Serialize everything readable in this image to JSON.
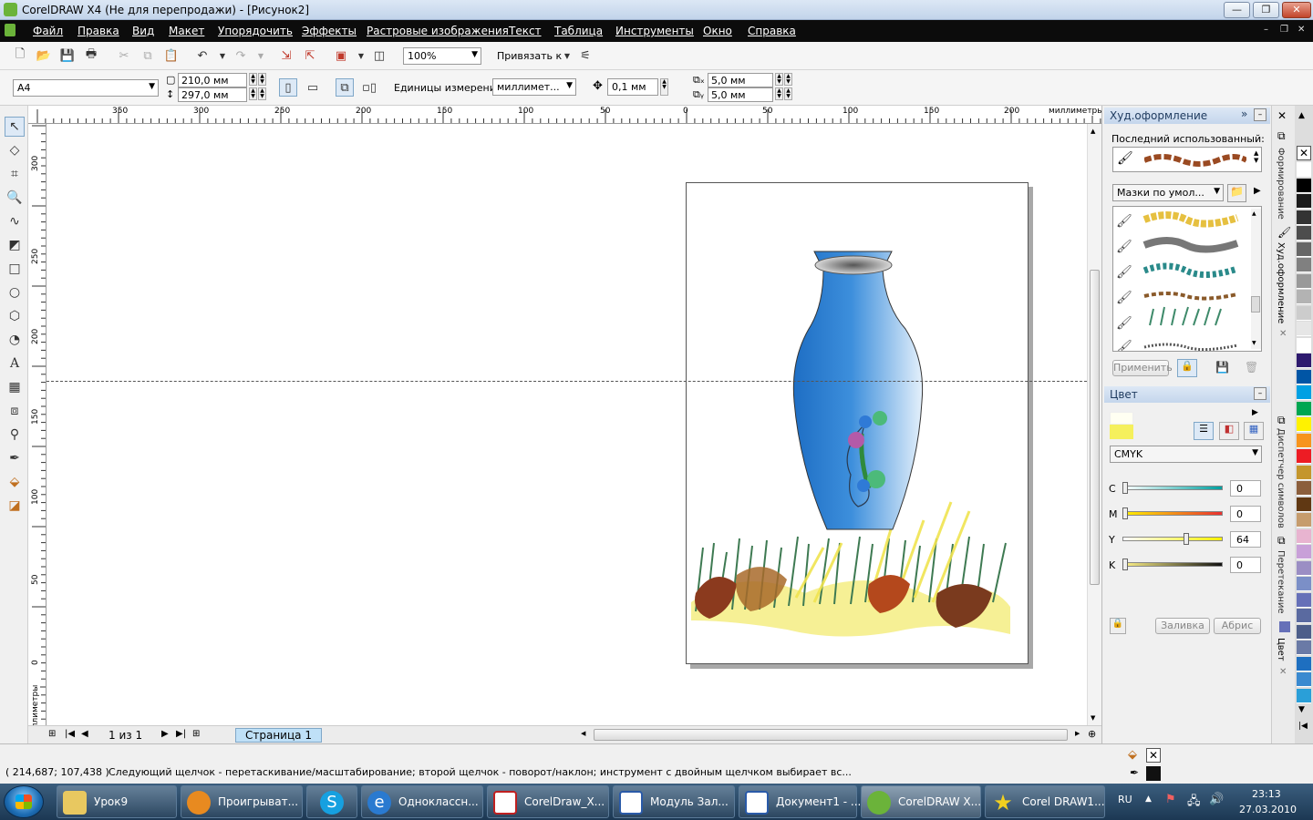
{
  "window": {
    "title": "CorelDRAW X4 (Не для перепродажи) - [Рисунок2]",
    "min": "—",
    "max": "❐",
    "close": "✕"
  },
  "menu": [
    "Файл",
    "Правка",
    "Вид",
    "Макет",
    "Упорядочить",
    "Эффекты",
    "Растровые изображения",
    "Текст",
    "Таблица",
    "Инструменты",
    "Окно",
    "Справка"
  ],
  "doc_controls": {
    "min": "–",
    "restore": "❐",
    "close": "✕"
  },
  "standard_bar": {
    "zoom": "100%",
    "snap_label": "Привязать к"
  },
  "property_bar": {
    "paper": "A4",
    "width": "210,0 мм",
    "height": "297,0 мм",
    "units_label": "Единицы измерения:",
    "units": "миллимет...",
    "nudge": "0,1 мм",
    "dup_x": "5,0 мм",
    "dup_y": "5,0 мм"
  },
  "ruler": {
    "h_ticks": [
      "350",
      "300",
      "250",
      "200",
      "150",
      "100",
      "50",
      "0",
      "50",
      "100",
      "150",
      "200"
    ],
    "unit": "миллиметры",
    "v_ticks": [
      "300",
      "250",
      "200",
      "150",
      "100",
      "50",
      "0"
    ],
    "v_unit": "миллиметры"
  },
  "page_nav": {
    "counter": "1 из 1",
    "tab": "Страница 1"
  },
  "artistic_docker": {
    "title": "Худ.оформление",
    "recent_label": "Последний использованный:",
    "library": "Мазки по умол...",
    "apply": "Применить"
  },
  "color_docker": {
    "title": "Цвет",
    "model": "CMYK",
    "channels": [
      {
        "label": "C",
        "value": "0",
        "level": 0
      },
      {
        "label": "M",
        "value": "0",
        "level": 0
      },
      {
        "label": "Y",
        "value": "64",
        "level": 64
      },
      {
        "label": "K",
        "value": "0",
        "level": 0
      }
    ],
    "fill_btn": "Заливка",
    "outline_btn": "Абрис"
  },
  "side_tabs": [
    "Формирование",
    "Худ.оформление",
    "Диспетчер символов",
    "Перетекание",
    "Цвет"
  ],
  "palette": [
    "#ffffff",
    "#000000",
    "#1a1a1a",
    "#333333",
    "#4d4d4d",
    "#666666",
    "#808080",
    "#999999",
    "#b3b3b3",
    "#cccccc",
    "#e6e6e6",
    "#ffffff",
    "#2e1a6e",
    "#0055a5",
    "#00a0e3",
    "#00a651",
    "#fff200",
    "#f7941d",
    "#ed1c24",
    "#c4962c",
    "#8b5e3c",
    "#603813",
    "#c69c6d",
    "#e8b4d0",
    "#c8a0d8",
    "#9b8ec4",
    "#7b8fc7",
    "#6670b8",
    "#5a6aa0",
    "#4d5e8a",
    "#6a7aa6",
    "#1e6fc0",
    "#3a8ad0",
    "#2a9fd8"
  ],
  "status": {
    "coords": "( 214,687; 107,438 )",
    "message": "Следующий щелчок - перетаскивание/масштабирование; второй щелчок - поворот/наклон; инструмент с двойным щелчком выбирает вс..."
  },
  "taskbar": {
    "items": [
      "Урок9",
      "Проигрыват...",
      "",
      "Одноклассн...",
      "CorelDraw_X...",
      "Модуль Зал...",
      "Документ1 - ...",
      "CorelDRAW X...",
      "Corel DRAW1..."
    ],
    "lang": "RU",
    "time": "23:13",
    "date": "27.03.2010"
  }
}
